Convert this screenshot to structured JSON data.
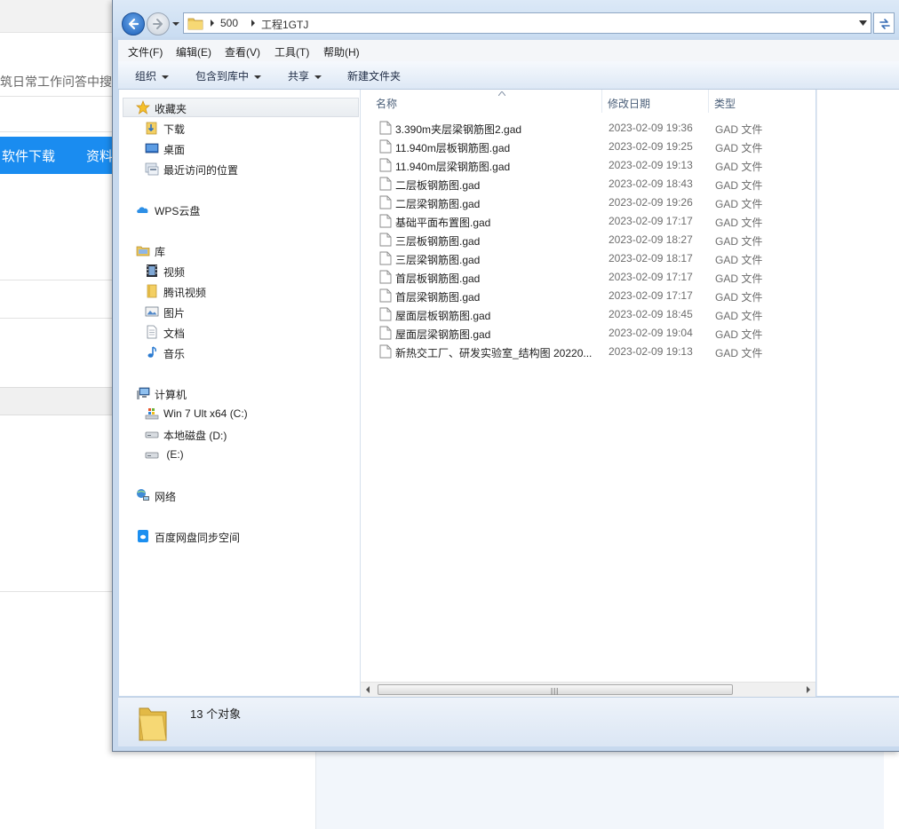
{
  "background_page": {
    "search_hint": "筑日常工作问答中搜",
    "nav_links": [
      "软件下载",
      "资料"
    ],
    "nav_color": "#1a8cf0"
  },
  "explorer": {
    "breadcrumb": [
      "500",
      "工程1GTJ"
    ],
    "menu": [
      "文件(F)",
      "编辑(E)",
      "查看(V)",
      "工具(T)",
      "帮助(H)"
    ],
    "toolbar": [
      "组织",
      "包含到库中",
      "共享",
      "新建文件夹"
    ],
    "nav_pane": {
      "favorites": {
        "label": "收藏夹",
        "icon": "star-icon"
      },
      "favorite_items": [
        {
          "label": "下载",
          "icon": "downloads-folder-icon"
        },
        {
          "label": "桌面",
          "icon": "desktop-icon"
        },
        {
          "label": "最近访问的位置",
          "icon": "recent-places-icon"
        }
      ],
      "wps": {
        "label": "WPS云盘",
        "icon": "cloud-icon"
      },
      "libraries": {
        "label": "库",
        "icon": "library-icon"
      },
      "library_items": [
        {
          "label": "视频",
          "icon": "video-icon"
        },
        {
          "label": "腾讯视频",
          "icon": "folder-icon"
        },
        {
          "label": "图片",
          "icon": "picture-icon"
        },
        {
          "label": "文档",
          "icon": "document-icon"
        },
        {
          "label": "音乐",
          "icon": "music-icon"
        }
      ],
      "computer": {
        "label": "计算机",
        "icon": "computer-icon"
      },
      "drives": [
        {
          "label": "Win 7 Ult x64 (C:)",
          "icon": "system-drive-icon"
        },
        {
          "label": "本地磁盘 (D:)",
          "icon": "drive-icon"
        },
        {
          "label": " (E:)",
          "icon": "drive-icon"
        }
      ],
      "network": {
        "label": "网络",
        "icon": "network-icon"
      },
      "baidu": {
        "label": "百度网盘同步空间",
        "icon": "baidu-netdisk-icon"
      }
    },
    "columns": {
      "name": "名称",
      "date": "修改日期",
      "type": "类型"
    },
    "files": [
      {
        "name": "3.390m夹层梁钢筋图2.gad",
        "date": "2023-02-09 19:36",
        "type": "GAD 文件"
      },
      {
        "name": "11.940m层板钢筋图.gad",
        "date": "2023-02-09 19:25",
        "type": "GAD 文件"
      },
      {
        "name": "11.940m层梁钢筋图.gad",
        "date": "2023-02-09 19:13",
        "type": "GAD 文件"
      },
      {
        "name": "二层板钢筋图.gad",
        "date": "2023-02-09 18:43",
        "type": "GAD 文件"
      },
      {
        "name": "二层梁钢筋图.gad",
        "date": "2023-02-09 19:26",
        "type": "GAD 文件"
      },
      {
        "name": "基础平面布置图.gad",
        "date": "2023-02-09 17:17",
        "type": "GAD 文件"
      },
      {
        "name": "三层板钢筋图.gad",
        "date": "2023-02-09 18:27",
        "type": "GAD 文件"
      },
      {
        "name": "三层梁钢筋图.gad",
        "date": "2023-02-09 18:17",
        "type": "GAD 文件"
      },
      {
        "name": "首层板钢筋图.gad",
        "date": "2023-02-09 17:17",
        "type": "GAD 文件"
      },
      {
        "name": "首层梁钢筋图.gad",
        "date": "2023-02-09 17:17",
        "type": "GAD 文件"
      },
      {
        "name": "屋面层板钢筋图.gad",
        "date": "2023-02-09 18:45",
        "type": "GAD 文件"
      },
      {
        "name": "屋面层梁钢筋图.gad",
        "date": "2023-02-09 19:04",
        "type": "GAD 文件"
      },
      {
        "name": "新热交工厂、研发实验室_结构图 20220...",
        "date": "2023-02-09 19:13",
        "type": "GAD 文件"
      }
    ],
    "status": "13 个对象"
  }
}
